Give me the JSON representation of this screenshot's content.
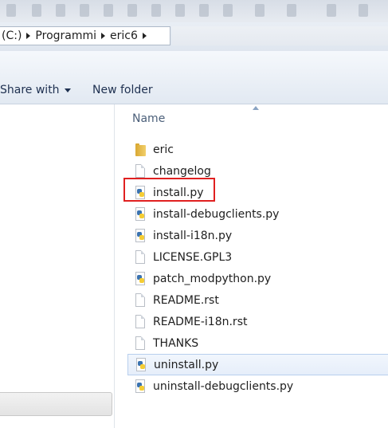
{
  "address_bar": {
    "crumbs": [
      "(C:)",
      "Programmi",
      "eric6"
    ]
  },
  "toolbar": {
    "share_label": "Share with",
    "new_folder_label": "New folder"
  },
  "file_list": {
    "column_header": "Name",
    "items": [
      {
        "name": "eric",
        "icon": "folder-icon"
      },
      {
        "name": "changelog",
        "icon": "document-icon"
      },
      {
        "name": "install.py",
        "icon": "python-file-icon"
      },
      {
        "name": "install-debugclients.py",
        "icon": "python-file-icon"
      },
      {
        "name": "install-i18n.py",
        "icon": "python-file-icon"
      },
      {
        "name": "LICENSE.GPL3",
        "icon": "document-icon"
      },
      {
        "name": "patch_modpython.py",
        "icon": "python-file-icon"
      },
      {
        "name": "README.rst",
        "icon": "document-icon"
      },
      {
        "name": "README-i18n.rst",
        "icon": "document-icon"
      },
      {
        "name": "THANKS",
        "icon": "document-icon"
      },
      {
        "name": "uninstall.py",
        "icon": "python-file-icon"
      },
      {
        "name": "uninstall-debugclients.py",
        "icon": "python-file-icon"
      }
    ],
    "selected_item": "uninstall.py",
    "highlighted_item": "install.py"
  },
  "colors": {
    "highlight_border": "#e02020",
    "selection_border": "#b8cfee"
  }
}
